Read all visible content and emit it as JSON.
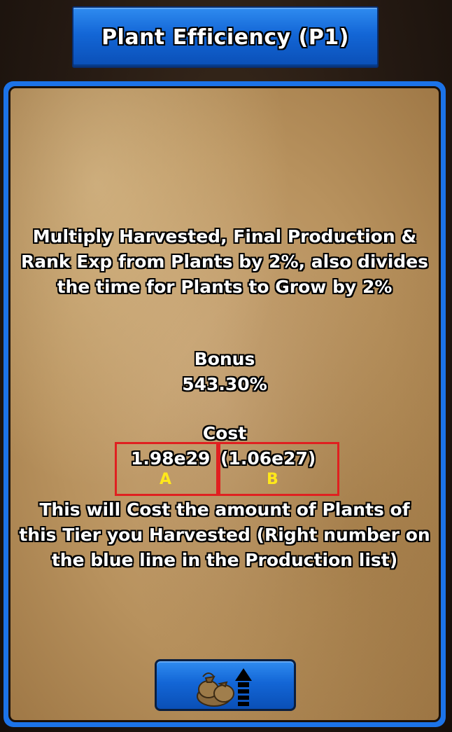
{
  "header": {
    "title": "Plant Efficiency (P1)"
  },
  "panel": {
    "description": "Multiply Harvested, Final Production & Rank Exp from Plants by 2%, also divides the time for Plants to Grow by 2%",
    "bonus_label": "Bonus",
    "bonus_value": "543.30%",
    "cost_label": "Cost",
    "cost_value": "1.98e29",
    "cost_harvested": "(1.06e27)",
    "marker_a": "A",
    "marker_b": "B",
    "note": "This will Cost the amount of Plants of this Tier you Harvested (Right number on the blue line in the Production list)"
  },
  "upgrade_button": {
    "icons": [
      "money-bag-icon",
      "arrow-up-icon"
    ]
  },
  "colors": {
    "accent_blue": "#1c73e8",
    "highlight_red": "#e02020",
    "marker_yellow": "#ffe81a",
    "parchment": "#c9a678"
  }
}
